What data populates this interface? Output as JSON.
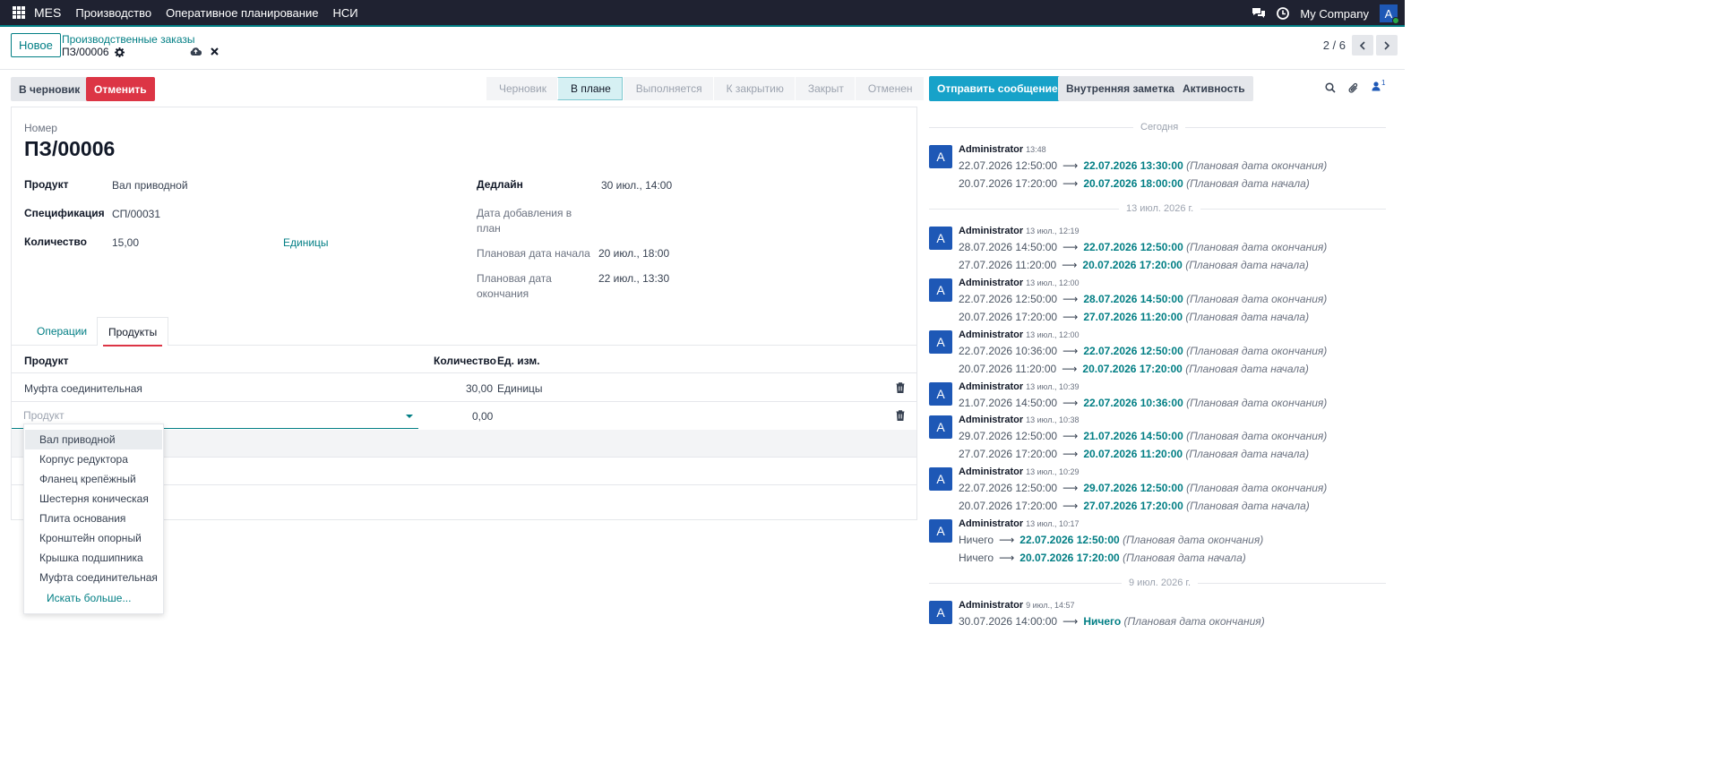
{
  "navbar": {
    "brand": "MES",
    "menus": [
      "Производство",
      "Оперативное планирование",
      "НСИ"
    ],
    "company": "My Company",
    "avatar_letter": "A"
  },
  "control_panel": {
    "new_label": "Новое",
    "breadcrumb_parent": "Производственные заказы",
    "breadcrumb_current": "ПЗ/00006",
    "pager": "2 / 6"
  },
  "actions": {
    "draft_label": "В черновик",
    "cancel_label": "Отменить"
  },
  "statusbar": {
    "stages": [
      "Черновик",
      "В плане",
      "Выполняется",
      "К закрытию",
      "Закрыт",
      "Отменен"
    ],
    "active": "В плане"
  },
  "form": {
    "number_label": "Номер",
    "number": "ПЗ/00006",
    "product_label": "Продукт",
    "product": "Вал приводной",
    "spec_label": "Спецификация",
    "spec": "СП/00031",
    "qty_label": "Количество",
    "qty": "15,00",
    "uom": "Единицы",
    "deadline_label": "Дедлайн",
    "deadline": "30 июл., 14:00",
    "added_label_1": "Дата добавления в",
    "added_label_2": "план",
    "plan_start_label": "Плановая дата начала",
    "plan_start": "20 июл., 18:00",
    "plan_end_label_1": "Плановая дата",
    "plan_end_label_2": "окончания",
    "plan_end": "22 июл., 13:30"
  },
  "tabs": {
    "operations": "Операции",
    "products": "Продукты"
  },
  "products_table": {
    "headers": {
      "product": "Продукт",
      "qty": "Количество",
      "uom": "Ед. изм."
    },
    "rows": [
      {
        "product": "Муфта соединительная",
        "qty": "30,00",
        "uom": "Единицы"
      }
    ],
    "new_row": {
      "placeholder": "Продукт",
      "qty": "0,00"
    }
  },
  "dropdown": {
    "items": [
      "Вал приводной",
      "Корпус редуктора",
      "Фланец крепёжный",
      "Шестерня коническая",
      "Плита основания",
      "Кронштейн опорный",
      "Крышка подшипника",
      "Муфта соединительная"
    ],
    "more": "Искать больше..."
  },
  "chatter": {
    "send_message": "Отправить сообщение",
    "internal_note": "Внутренняя заметка",
    "activity": "Активность",
    "followers_count": "1",
    "separators": [
      "Сегодня",
      "13 июл. 2026 г.",
      "9 июл. 2026 г."
    ],
    "messages": [
      {
        "author": "Administrator",
        "time": "13:48",
        "lines": [
          {
            "old": "22.07.2026 12:50:00",
            "new": "22.07.2026 13:30:00",
            "field": "(Плановая дата окончания)"
          },
          {
            "old": "20.07.2026 17:20:00",
            "new": "20.07.2026 18:00:00",
            "field": "(Плановая дата начала)"
          }
        ]
      },
      {
        "author": "Administrator",
        "time": "13 июл., 12:19",
        "lines": [
          {
            "old": "28.07.2026 14:50:00",
            "new": "22.07.2026 12:50:00",
            "field": "(Плановая дата окончания)"
          },
          {
            "old": "27.07.2026 11:20:00",
            "new": "20.07.2026 17:20:00",
            "field": "(Плановая дата начала)"
          }
        ]
      },
      {
        "author": "Administrator",
        "time": "13 июл., 12:00",
        "lines": [
          {
            "old": "22.07.2026 12:50:00",
            "new": "28.07.2026 14:50:00",
            "field": "(Плановая дата окончания)"
          },
          {
            "old": "20.07.2026 17:20:00",
            "new": "27.07.2026 11:20:00",
            "field": "(Плановая дата начала)"
          }
        ]
      },
      {
        "author": "Administrator",
        "time": "13 июл., 12:00",
        "lines": [
          {
            "old": "22.07.2026 10:36:00",
            "new": "22.07.2026 12:50:00",
            "field": "(Плановая дата окончания)"
          },
          {
            "old": "20.07.2026 11:20:00",
            "new": "20.07.2026 17:20:00",
            "field": "(Плановая дата начала)"
          }
        ]
      },
      {
        "author": "Administrator",
        "time": "13 июл., 10:39",
        "lines": [
          {
            "old": "21.07.2026 14:50:00",
            "new": "22.07.2026 10:36:00",
            "field": "(Плановая дата окончания)"
          }
        ]
      },
      {
        "author": "Administrator",
        "time": "13 июл., 10:38",
        "lines": [
          {
            "old": "29.07.2026 12:50:00",
            "new": "21.07.2026 14:50:00",
            "field": "(Плановая дата окончания)"
          },
          {
            "old": "27.07.2026 17:20:00",
            "new": "20.07.2026 11:20:00",
            "field": "(Плановая дата начала)"
          }
        ]
      },
      {
        "author": "Administrator",
        "time": "13 июл., 10:29",
        "lines": [
          {
            "old": "22.07.2026 12:50:00",
            "new": "29.07.2026 12:50:00",
            "field": "(Плановая дата окончания)"
          },
          {
            "old": "20.07.2026 17:20:00",
            "new": "27.07.2026 17:20:00",
            "field": "(Плановая дата начала)"
          }
        ]
      },
      {
        "author": "Administrator",
        "time": "13 июл., 10:17",
        "lines": [
          {
            "old": "Ничего",
            "new": "22.07.2026 12:50:00",
            "field": "(Плановая дата окончания)"
          },
          {
            "old": "Ничего",
            "new": "20.07.2026 17:20:00",
            "field": "(Плановая дата начала)"
          }
        ]
      },
      {
        "author": "Administrator",
        "time": "9 июл., 14:57",
        "lines": [
          {
            "old": "30.07.2026 14:00:00",
            "new": "Ничего",
            "field": "(Плановая дата окончания)"
          }
        ]
      }
    ]
  },
  "colors": {
    "brand": "#017e84",
    "navbar": "#1f2231",
    "danger": "#dc3545",
    "primary": "#17a2c9",
    "avatar": "#1e58b6"
  }
}
